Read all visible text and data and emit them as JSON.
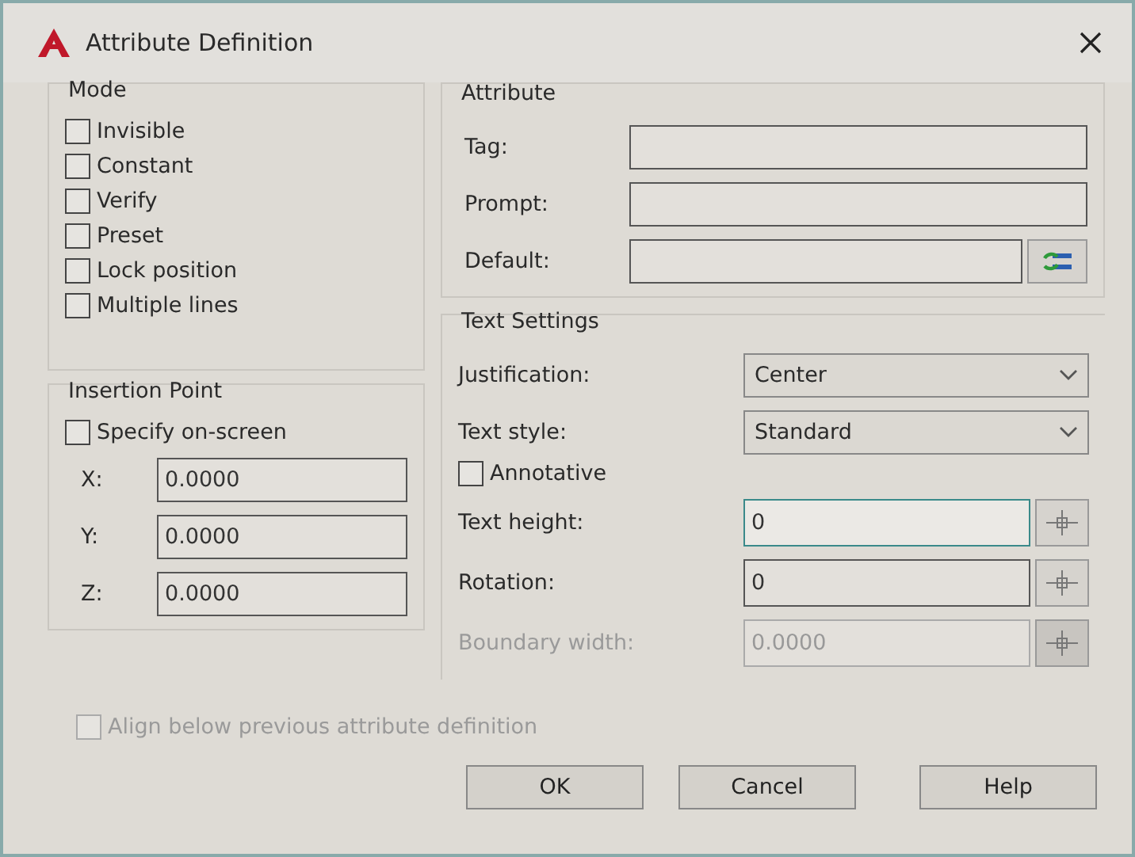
{
  "window": {
    "title": "Attribute Definition"
  },
  "mode": {
    "title": "Mode",
    "options": [
      {
        "label": "Invisible",
        "checked": false
      },
      {
        "label": "Constant",
        "checked": false
      },
      {
        "label": "Verify",
        "checked": false
      },
      {
        "label": "Preset",
        "checked": false
      },
      {
        "label": "Lock position",
        "checked": false
      },
      {
        "label": "Multiple lines",
        "checked": false
      }
    ]
  },
  "insertion_point": {
    "title": "Insertion Point",
    "specify": {
      "label": "Specify on-screen",
      "checked": false
    },
    "fields": [
      {
        "label": "X:",
        "value": "0.0000"
      },
      {
        "label": "Y:",
        "value": "0.0000"
      },
      {
        "label": "Z:",
        "value": "0.0000"
      }
    ]
  },
  "attribute": {
    "title": "Attribute",
    "fields": [
      {
        "label": "Tag:",
        "kind": "text"
      },
      {
        "label": "Prompt:",
        "kind": "text"
      },
      {
        "label": "Default:",
        "kind": "insert"
      }
    ]
  },
  "text_settings": {
    "title": "Text Settings",
    "rows": [
      {
        "kind": "select",
        "label": "Justification:",
        "value": "Center"
      },
      {
        "kind": "select",
        "label": "Text style:",
        "value": "Standard"
      },
      {
        "kind": "check",
        "label": "Annotative",
        "checked": false
      },
      {
        "kind": "pick",
        "label": "Text height:",
        "value": "0",
        "focused": true,
        "disabled": false
      },
      {
        "kind": "pick",
        "label": "Rotation:",
        "value": "0",
        "focused": false,
        "disabled": false
      },
      {
        "kind": "pick",
        "label": "Boundary width:",
        "value": "0.0000",
        "focused": false,
        "disabled": true
      }
    ]
  },
  "align": {
    "label": "Align below previous attribute definition",
    "checked": false,
    "disabled": true
  },
  "buttons": [
    "OK",
    "Cancel",
    "Help"
  ]
}
